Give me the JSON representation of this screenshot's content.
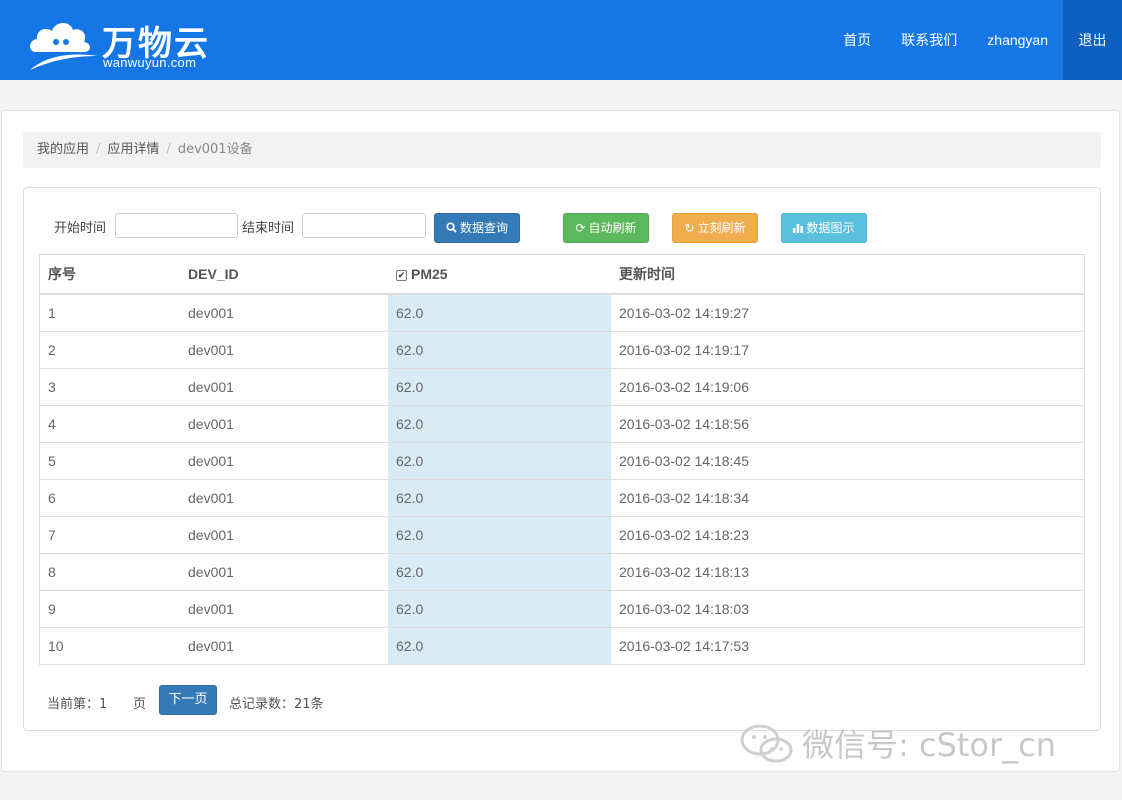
{
  "navbar": {
    "logo_cn": "万物云",
    "logo_en": "wanwuyun.com",
    "links": [
      "首页",
      "联系我们",
      "zhangyan",
      "退出"
    ]
  },
  "breadcrumb": [
    "我的应用",
    "应用详情",
    "dev001设备"
  ],
  "filter": {
    "start_label": "开始时间",
    "end_label": "结束时间",
    "start_value": "",
    "end_value": "",
    "buttons": {
      "query": "数据查询",
      "auto_refresh": "自动刷新",
      "refresh_now": "立刻刷新",
      "chart": "数据图示"
    }
  },
  "table": {
    "headers": [
      "序号",
      "DEV_ID",
      "PM25",
      "更新时间"
    ],
    "pm25_checked": true,
    "rows": [
      [
        "1",
        "dev001",
        "62.0",
        "2016-03-02 14:19:27"
      ],
      [
        "2",
        "dev001",
        "62.0",
        "2016-03-02 14:19:17"
      ],
      [
        "3",
        "dev001",
        "62.0",
        "2016-03-02 14:19:06"
      ],
      [
        "4",
        "dev001",
        "62.0",
        "2016-03-02 14:18:56"
      ],
      [
        "5",
        "dev001",
        "62.0",
        "2016-03-02 14:18:45"
      ],
      [
        "6",
        "dev001",
        "62.0",
        "2016-03-02 14:18:34"
      ],
      [
        "7",
        "dev001",
        "62.0",
        "2016-03-02 14:18:23"
      ],
      [
        "8",
        "dev001",
        "62.0",
        "2016-03-02 14:18:13"
      ],
      [
        "9",
        "dev001",
        "62.0",
        "2016-03-02 14:18:03"
      ],
      [
        "10",
        "dev001",
        "62.0",
        "2016-03-02 14:17:53"
      ]
    ]
  },
  "pager": {
    "current": "当前第：1",
    "page_suffix": "页",
    "next": "下一页",
    "total": "总记录数：21条"
  },
  "watermark": "微信号: cStor_cn",
  "colors": {
    "navbar": "#1577e6",
    "logout_bg": "#0d5fc0",
    "primary": "#337ab7",
    "success": "#5cb85c",
    "warning": "#f0ad4e",
    "info": "#5bc0de",
    "highlight_column": "#d9ecf5"
  },
  "icons": {
    "logo": "cloud-icon",
    "query": "search-icon",
    "auto_refresh": "refresh-icon",
    "refresh_now": "redo-icon",
    "chart": "bar-chart-icon",
    "watermark": "wechat-icon"
  }
}
